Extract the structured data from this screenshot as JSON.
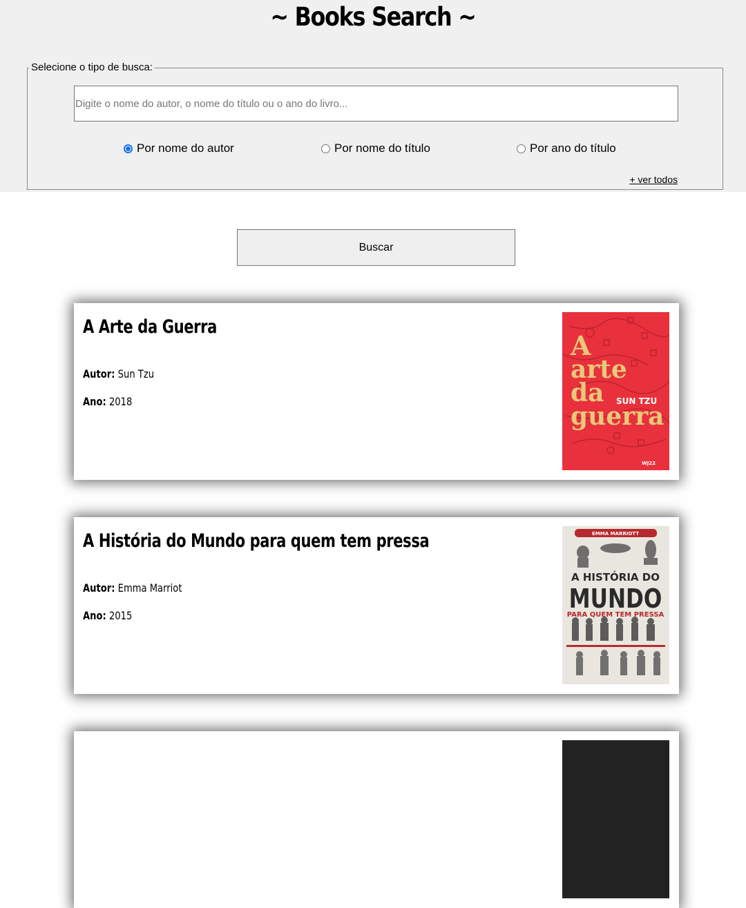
{
  "header": {
    "title": "~ Books Search ~"
  },
  "search": {
    "legend": "Selecione o tipo de busca:",
    "placeholder": "Digite o nome do autor, o nome do título ou o ano do livro...",
    "value": "",
    "options": [
      {
        "label": "Por nome do autor",
        "checked": true
      },
      {
        "label": "Por nome do título",
        "checked": false
      },
      {
        "label": "Por ano do título",
        "checked": false
      }
    ],
    "see_all": "+ ver todos",
    "button": "Buscar"
  },
  "labels": {
    "author": "Autor:",
    "year": "Ano:"
  },
  "books": [
    {
      "title": "A Arte da Guerra",
      "author": "Sun Tzu",
      "year": "2018",
      "cover": {
        "lines": [
          "A",
          "arte",
          "da",
          "guerra"
        ],
        "author": "SUN TZU",
        "publisher": "WJ22",
        "bg": "#e8313c",
        "accent": "#e8c87a"
      }
    },
    {
      "title": "A História do Mundo para quem tem pressa",
      "author": "Emma Marriot",
      "year": "2015",
      "cover": {
        "author": "EMMA MARRIOTT",
        "line1": "A HISTÓRIA DO",
        "line2": "MUNDO",
        "line3": "PARA QUEM TEM PRESSA",
        "bg": "#e9e6df",
        "accent": "#b8292d"
      }
    }
  ]
}
